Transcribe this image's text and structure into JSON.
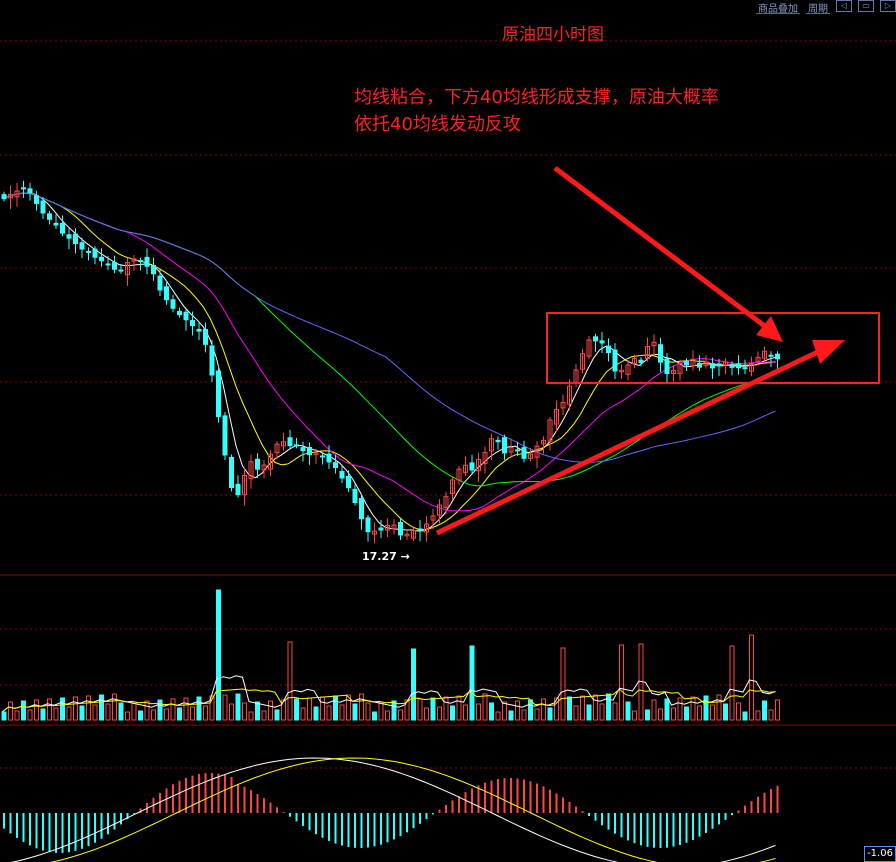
{
  "toolbar": {
    "overlay_label": "商品叠加",
    "period_label": "周期",
    "nav_left": "◁",
    "nav_right": "▷",
    "nav_box": "▭"
  },
  "chart_title": "原油四小时图",
  "annotation": {
    "line1": "均线粘合，下方40均线形成支撑，原油大概率",
    "line2": "依托40均线发动反攻"
  },
  "low_marker": "17.27 →",
  "macd_value": "-1.06",
  "colors": {
    "up": "#ff4444",
    "down": "#33ffff",
    "grid": "#8b0000",
    "annotation": "#ff2020",
    "ma5": "#ffffff",
    "ma10": "#ffff00",
    "ma20": "#ff00ff",
    "ma40": "#00ff00",
    "ma60": "#6666ff"
  },
  "chart_data": [
    {
      "type": "candlestick",
      "title": "原油四小时图",
      "low_label": "17.27",
      "note": "K线：下跌后于17.27见底，反弹后横盘整理；均线粘合，下方40均线形成支撑"
    },
    {
      "type": "bar",
      "panel": "volume"
    },
    {
      "type": "bar",
      "panel": "macd",
      "last_value": -1.06
    }
  ]
}
